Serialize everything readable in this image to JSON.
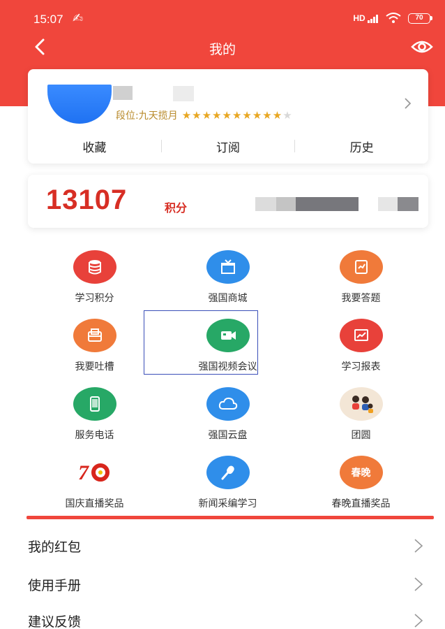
{
  "status_bar": {
    "time": "15:07",
    "extra_icon": "notification-icon",
    "signal": "HD",
    "battery": "70"
  },
  "nav": {
    "title": "我的",
    "back_icon": "back-arrow-icon",
    "eye_icon": "eye-icon"
  },
  "profile": {
    "rank_text": "段位:九天揽月",
    "stars_filled": "★★★★★★★★★★",
    "stars_empty": "★",
    "tabs": [
      "收藏",
      "订阅",
      "历史"
    ]
  },
  "points": {
    "value": "13107",
    "unit": "积分"
  },
  "features": [
    {
      "label": "学习积分",
      "icon": "database-icon",
      "color": "#e8413a"
    },
    {
      "label": "强国商城",
      "icon": "gift-box-icon",
      "color": "#2f8eea"
    },
    {
      "label": "我要答题",
      "icon": "quiz-paper-icon",
      "color": "#f07a3a"
    },
    {
      "label": "我要吐槽",
      "icon": "mailbox-icon",
      "color": "#f07a3a"
    },
    {
      "label": "强国视频会议",
      "icon": "video-camera-icon",
      "color": "#27a866"
    },
    {
      "label": "学习报表",
      "icon": "chart-report-icon",
      "color": "#e8413a"
    },
    {
      "label": "服务电话",
      "icon": "phone-icon",
      "color": "#27a866"
    },
    {
      "label": "强国云盘",
      "icon": "cloud-icon",
      "color": "#2f8eea"
    },
    {
      "label": "团圆",
      "icon": "reunion-people-icon",
      "color": "#f3e6d6"
    },
    {
      "label": "国庆直播奖品",
      "icon": "seventy-anniversary-icon",
      "color": "#ffffff"
    },
    {
      "label": "新闻采编学习",
      "icon": "microphone-icon",
      "color": "#2f8eea"
    },
    {
      "label": "春晚直播奖品",
      "icon": "spring-gala-icon",
      "color": "#f07a3a",
      "badge": "春晚"
    }
  ],
  "menu": [
    {
      "label": "我的红包"
    },
    {
      "label": "使用手册"
    },
    {
      "label": "建议反馈"
    }
  ],
  "colors": {
    "header": "#f0463c",
    "points": "#d72e24",
    "highlight_border": "#3a4fb8"
  }
}
